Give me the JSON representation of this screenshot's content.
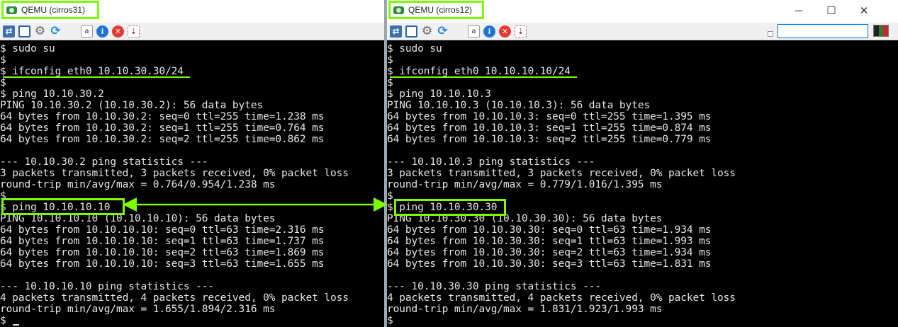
{
  "windows": [
    {
      "id": "left",
      "title": "QEMU (cirros31)",
      "terminal_lines": [
        "$ sudo su",
        "$",
        "$ ifconfig eth0 10.10.30.30/24",
        "$",
        "$ ping 10.10.30.2",
        "PING 10.10.30.2 (10.10.30.2): 56 data bytes",
        "64 bytes from 10.10.30.2: seq=0 ttl=255 time=1.238 ms",
        "64 bytes from 10.10.30.2: seq=1 ttl=255 time=0.764 ms",
        "64 bytes from 10.10.30.2: seq=2 ttl=255 time=0.862 ms",
        "",
        "--- 10.10.30.2 ping statistics ---",
        "3 packets transmitted, 3 packets received, 0% packet loss",
        "round-trip min/avg/max = 0.764/0.954/1.238 ms",
        "$",
        "$ ping 10.10.10.10",
        "PING 10.10.10.10 (10.10.10.10): 56 data bytes",
        "64 bytes from 10.10.10.10: seq=0 ttl=63 time=2.316 ms",
        "64 bytes from 10.10.10.10: seq=1 ttl=63 time=1.737 ms",
        "64 bytes from 10.10.10.10: seq=2 ttl=63 time=1.869 ms",
        "64 bytes from 10.10.10.10: seq=3 ttl=63 time=1.655 ms",
        "",
        "--- 10.10.10.10 ping statistics ---",
        "4 packets transmitted, 4 packets received, 0% packet loss",
        "round-trip min/avg/max = 1.655/1.894/2.316 ms",
        "$"
      ]
    },
    {
      "id": "right",
      "title": "QEMU (cirros12)",
      "terminal_lines": [
        "$ sudo su",
        "$",
        "$ ifconfig eth0 10.10.10.10/24",
        "$",
        "$ ping 10.10.10.3",
        "PING 10.10.10.3 (10.10.10.3): 56 data bytes",
        "64 bytes from 10.10.10.3: seq=0 ttl=255 time=1.395 ms",
        "64 bytes from 10.10.10.3: seq=1 ttl=255 time=0.874 ms",
        "64 bytes from 10.10.10.3: seq=2 ttl=255 time=0.779 ms",
        "",
        "--- 10.10.10.3 ping statistics ---",
        "3 packets transmitted, 3 packets received, 0% packet loss",
        "round-trip min/avg/max = 0.779/1.016/1.395 ms",
        "$",
        "$ ping 10.10.30.30",
        "PING 10.10.30.30 (10.10.30.30): 56 data bytes",
        "64 bytes from 10.10.30.30: seq=0 ttl=63 time=1.934 ms",
        "64 bytes from 10.10.30.30: seq=1 ttl=63 time=1.993 ms",
        "64 bytes from 10.10.30.30: seq=2 ttl=63 time=1.934 ms",
        "64 bytes from 10.10.30.30: seq=3 ttl=63 time=1.831 ms",
        "",
        "--- 10.10.30.30 ping statistics ---",
        "4 packets transmitted, 4 packets received, 0% packet loss",
        "round-trip min/avg/max = 1.831/1.923/1.993 ms",
        "$"
      ]
    }
  ],
  "window_controls": {
    "minimize": "─",
    "maximize": "☐",
    "close": "✕"
  },
  "toolbar_icons": [
    "connect-icon",
    "fullscreen-icon",
    "gear-icon",
    "refresh-icon",
    "windows-icon",
    "text-icon",
    "info-icon",
    "close-circle-icon",
    "download-icon"
  ],
  "toolbar_glyphs": {
    "text": "a",
    "info": "i",
    "close": "✕",
    "download": "⇣",
    "gear": "⚙",
    "refresh": "⟳",
    "connect": "⇄"
  },
  "search": {
    "value": ""
  },
  "colors": {
    "highlight": "#7CFC00",
    "terminal_bg": "#000000",
    "terminal_fg": "#e6e6e6"
  }
}
